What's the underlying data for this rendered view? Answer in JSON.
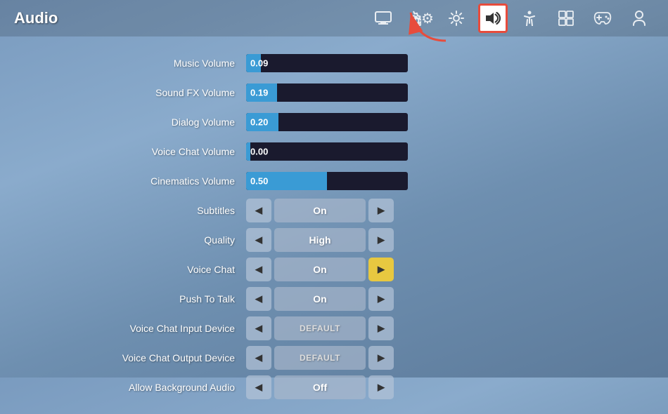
{
  "header": {
    "title": "Audio",
    "nav_items": [
      {
        "id": "monitor",
        "icon": "🖥",
        "label": "Display",
        "active": false
      },
      {
        "id": "gear",
        "icon": "⚙",
        "label": "Settings",
        "active": false
      },
      {
        "id": "brightness",
        "icon": "☀",
        "label": "Brightness",
        "active": false
      },
      {
        "id": "audio",
        "icon": "🔊",
        "label": "Audio",
        "active": true
      },
      {
        "id": "accessibility",
        "icon": "♿",
        "label": "Accessibility",
        "active": false
      },
      {
        "id": "network",
        "icon": "⊞",
        "label": "Network",
        "active": false
      },
      {
        "id": "gamepad",
        "icon": "🎮",
        "label": "Gamepad",
        "active": false
      },
      {
        "id": "user",
        "icon": "👤",
        "label": "User",
        "active": false
      }
    ]
  },
  "settings": [
    {
      "id": "music-volume",
      "label": "Music Volume",
      "type": "slider",
      "value": "0.09",
      "fill_pct": 9
    },
    {
      "id": "sound-fx-volume",
      "label": "Sound FX Volume",
      "type": "slider",
      "value": "0.19",
      "fill_pct": 19
    },
    {
      "id": "dialog-volume",
      "label": "Dialog Volume",
      "type": "slider",
      "value": "0.20",
      "fill_pct": 20
    },
    {
      "id": "voice-chat-volume",
      "label": "Voice Chat Volume",
      "type": "slider",
      "value": "0.00",
      "fill_pct": 0
    },
    {
      "id": "cinematics-volume",
      "label": "Cinematics Volume",
      "type": "slider",
      "value": "0.50",
      "fill_pct": 50
    },
    {
      "id": "subtitles",
      "label": "Subtitles",
      "type": "toggle",
      "value": "On",
      "right_highlighted": false
    },
    {
      "id": "quality",
      "label": "Quality",
      "type": "toggle",
      "value": "High",
      "right_highlighted": false
    },
    {
      "id": "voice-chat",
      "label": "Voice Chat",
      "type": "toggle",
      "value": "On",
      "right_highlighted": true
    },
    {
      "id": "push-to-talk",
      "label": "Push To Talk",
      "type": "toggle",
      "value": "On",
      "right_highlighted": false
    },
    {
      "id": "voice-chat-input-device",
      "label": "Voice Chat Input Device",
      "type": "toggle",
      "value": "DEFAULT",
      "device": true,
      "right_highlighted": false
    },
    {
      "id": "voice-chat-output-device",
      "label": "Voice Chat Output Device",
      "type": "toggle",
      "value": "DEFAULT",
      "device": true,
      "right_highlighted": false
    },
    {
      "id": "allow-background-audio",
      "label": "Allow Background Audio",
      "type": "toggle",
      "value": "Off",
      "right_highlighted": false
    }
  ],
  "arrow": {
    "label": "arrow pointing to audio icon"
  }
}
